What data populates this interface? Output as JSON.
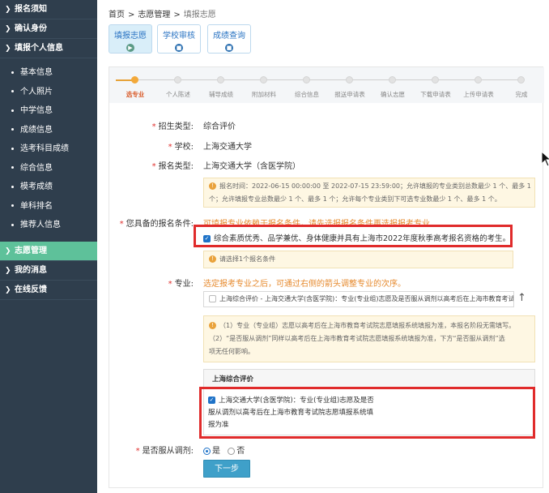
{
  "sidebar": {
    "top_sections": [
      {
        "label": "报名须知"
      },
      {
        "label": "确认身份"
      },
      {
        "label": "填报个人信息"
      }
    ],
    "sub_items": [
      {
        "label": "基本信息"
      },
      {
        "label": "个人照片"
      },
      {
        "label": "中学信息"
      },
      {
        "label": "成绩信息"
      },
      {
        "label": "选考科目成绩"
      },
      {
        "label": "综合信息"
      },
      {
        "label": "模考成绩"
      },
      {
        "label": "单科排名"
      },
      {
        "label": "推荐人信息"
      }
    ],
    "bottom_sections": [
      {
        "label": "志愿管理",
        "active": true
      },
      {
        "label": "我的消息"
      },
      {
        "label": "在线反馈"
      }
    ]
  },
  "breadcrumb": {
    "home": "首页",
    "level1": "志愿管理",
    "level2": "填报志愿",
    "sep": ">"
  },
  "tabs": [
    {
      "label": "填报志愿",
      "icon": "▶"
    },
    {
      "label": "学校审核",
      "icon": "■"
    },
    {
      "label": "成绩查询",
      "icon": "■"
    }
  ],
  "steps": [
    {
      "label": "选专业"
    },
    {
      "label": "个人陈述"
    },
    {
      "label": "辅导成绩"
    },
    {
      "label": "附加材料"
    },
    {
      "label": "综合信息"
    },
    {
      "label": "报送申请表"
    },
    {
      "label": "确认志愿"
    },
    {
      "label": "下载申请表"
    },
    {
      "label": "上传申请表"
    },
    {
      "label": "完成"
    }
  ],
  "form": {
    "req_mark": "*",
    "enroll_type_label": "招生类型:",
    "enroll_type_value": "综合评价",
    "school_label": "学校:",
    "school_value": "上海交通大学",
    "apply_type_label": "报名类型:",
    "apply_type_value": "上海交通大学（含医学院）",
    "time_note_line1": "报名时间：2022-06-15 00:00:00 至 2022-07-15 23:59:00；允许填报的专业类别总数最少 1 个、最多 1",
    "time_note_line2": "个；允许填报专业总数最少 1 个、最多 1 个；允许每个专业类别下可选专业数最少 1 个、最多 1 个。",
    "condition_label": "您具备的报名条件:",
    "condition_hint": "可填报专业依赖于报名条件，请先选报报名条件再选报报考专业",
    "condition_option": "综合素质优秀、品学兼优、身体健康并具有上海市2022年度秋季高考报名资格的考生。",
    "condition_note": "请选择1个报名条件",
    "major_label": "专业:",
    "major_hint": "选定报考专业之后，可通过右侧的箭头调整专业的次序。",
    "major_select": "上海综合评价 - 上海交通大学(含医学院)：专业(专业组)志愿及是否服从调剂以高考后在上海市教育考试院志愿填报系统填报为准。",
    "arrow_up": "↑",
    "major_note_line1": "（1）专业（专业组）志愿以高考后在上海市教育考试院志愿填报系统填报为准，本报名阶段无需填写。",
    "major_note_line2": "（2）“是否服从调剂”同样以高考后在上海市教育考试院志愿填报系统填报为准，下方“是否服从调剂”选",
    "major_note_line3": "项无任何影响。",
    "group_title": "上海综合评价",
    "group_option_line1": "上海交通大学(含医学院)：专业(专业组)志愿及是否",
    "group_option_line2": "服从调剂以高考后在上海市教育考试院志愿填报系统填",
    "group_option_line3": "报为准",
    "adjust_label": "是否服从调剂:",
    "adjust_yes": "是",
    "adjust_no": "否",
    "next_button": "下一步"
  },
  "colors": {
    "sidebar_bg": "#2f3e4d",
    "sidebar_active": "#5ec19a",
    "accent_blue": "#2b74c3",
    "required_red": "#e0302e",
    "hint_orange": "#e68a2e",
    "highlight_red": "#e02b2b",
    "button_bg": "#3fa0c9"
  },
  "icons": {
    "chevron": "chevron-right-icon",
    "info": "info-icon",
    "cursor": "mouse-cursor-icon"
  }
}
